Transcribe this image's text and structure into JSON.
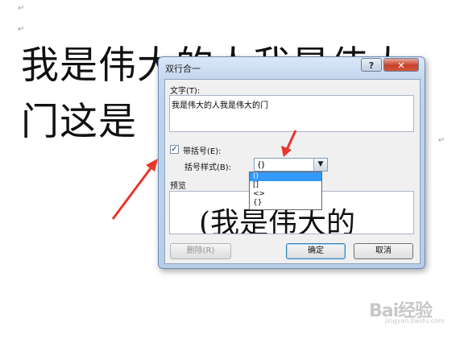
{
  "document": {
    "line1": "我是伟大的人我是伟大",
    "line2": "门这是",
    "para_mark": "↵"
  },
  "dialog": {
    "title": "双行合一",
    "help_label": "?",
    "close_label": "✕",
    "text_label": "文字(T):",
    "text_value": "我是伟大的人我是伟大的门",
    "bracket_checkbox_label": "带括号(E):",
    "bracket_checked": true,
    "bracket_style_label": "括号样式(B):",
    "bracket_style_value": "()",
    "bracket_options": [
      "()",
      "[]",
      "<>",
      "{}"
    ],
    "preview_label": "预览",
    "preview_text": "(我是伟大的",
    "delete_button": "删除(R)",
    "ok_button": "确定",
    "cancel_button": "取消"
  },
  "watermark": {
    "brand": "Bai经验",
    "url": "jingyan.baidu.com"
  },
  "colors": {
    "arrow": "#e8362a",
    "selection": "#3399ff"
  }
}
